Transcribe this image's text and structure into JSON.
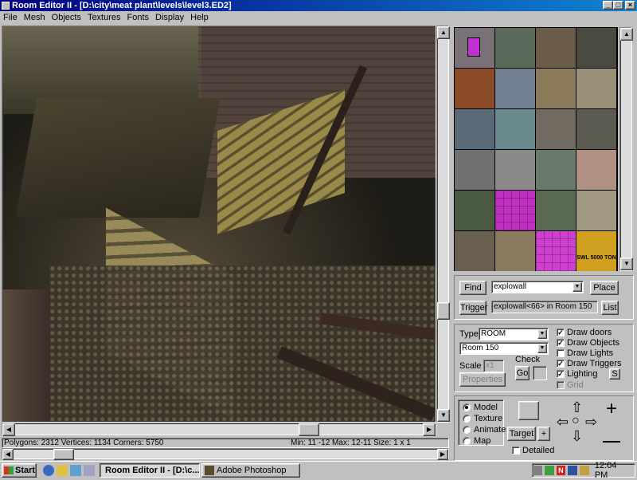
{
  "window": {
    "title": "Room Editor II - [D:\\city\\meat plant\\levels\\level3.ED2]",
    "min": "_",
    "max": "□",
    "close": "×"
  },
  "menu": [
    "File",
    "Mesh",
    "Objects",
    "Textures",
    "Fonts",
    "Display",
    "Help"
  ],
  "status": {
    "left": "Polygons: 2312  Vertices: 1134  Corners: 5750",
    "right": "Min: 11 -12  Max: 12-11  Size: 1 x 1"
  },
  "textures": {
    "colors": [
      "#7a7078",
      "#5a6a5a",
      "#6a5c48",
      "#4a4a40",
      "#8a4a28",
      "#708090",
      "#8a7a5a",
      "#9a9078",
      "#5a6a78",
      "#6a8a90",
      "#706a60",
      "#5a5a50",
      "#707070",
      "#8a8a88",
      "#6a7a6a",
      "#b09080",
      "#4a5a40",
      "#c030c0",
      "#5a6a50",
      "#a09880",
      "#6a6050",
      "#8a7a60",
      "#d040d0",
      "#d0a020"
    ],
    "signs": {
      "pink": "#c030d0",
      "sign_text": "SWL 5000 TON"
    }
  },
  "find": {
    "find_label": "Find",
    "find_value": "explowall",
    "place_label": "Place",
    "trigger_label": "Trigger",
    "trigger_value": "explowall<66> in Room 150",
    "list_label": "List"
  },
  "props": {
    "type_label": "Type",
    "type_value": "ROOM",
    "room_value": "Room 150",
    "scale_label": "Scale",
    "scale_value": "x1",
    "check_label": "Check",
    "go_label": "Go",
    "properties_label": "Properties",
    "draw_doors": "Draw doors",
    "draw_objects": "Draw Objects",
    "draw_lights": "Draw Lights",
    "draw_triggers": "Draw Triggers",
    "lighting": "Lighting",
    "s_label": "S",
    "grid": "Grid"
  },
  "mode": {
    "model": "Model",
    "texture": "Texture",
    "animate": "Animate",
    "map": "Map",
    "target_label": "Target",
    "plus_label": "+",
    "detailed": "Detailed"
  },
  "taskbar": {
    "start": "Start",
    "task1": "Room Editor II - [D:\\c...",
    "task2": "Adobe Photoshop",
    "clock": "12:04 PM"
  }
}
